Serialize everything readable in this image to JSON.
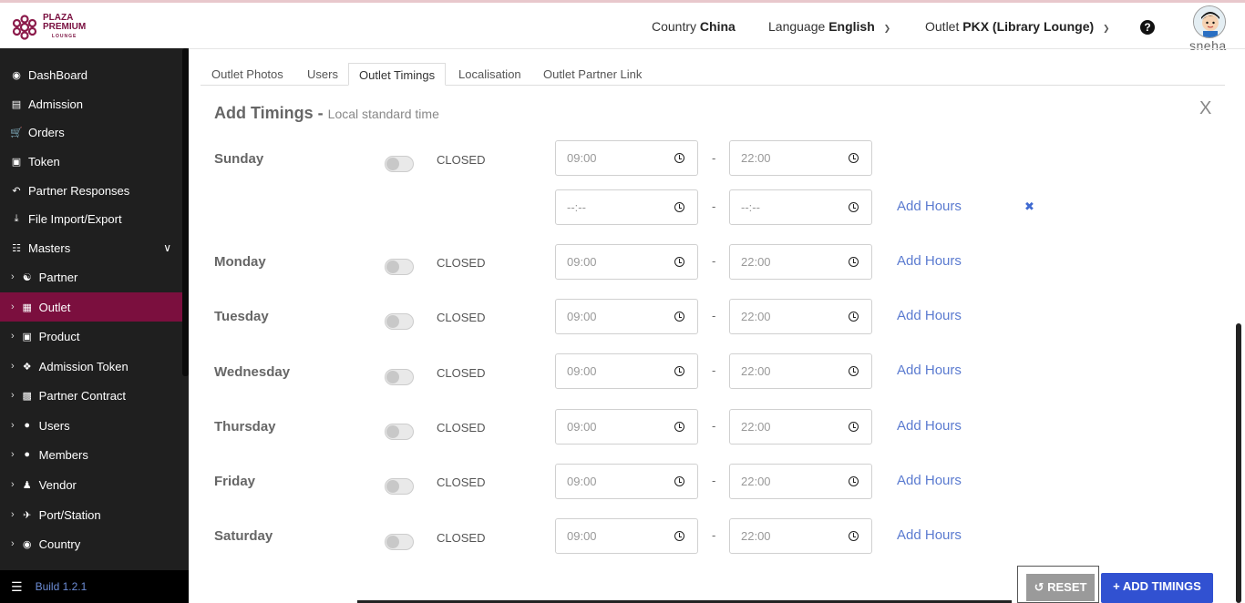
{
  "header": {
    "logo": {
      "line1": "PLAZA",
      "line2": "PREMIUM",
      "line3": "LOUNGE"
    },
    "country_label": "Country",
    "country_value": "China",
    "language_label": "Language",
    "language_value": "English",
    "outlet_label": "Outlet",
    "outlet_value": "PKX (Library Lounge)",
    "help_icon": "?",
    "username": "sneha"
  },
  "sidebar": {
    "items": [
      {
        "label": "DashBoard",
        "icon": "dashboard-icon"
      },
      {
        "label": "Admission",
        "icon": "id-card-icon"
      },
      {
        "label": "Orders",
        "icon": "cart-icon"
      },
      {
        "label": "Token",
        "icon": "document-icon"
      },
      {
        "label": "Partner Responses",
        "icon": "reply-icon"
      },
      {
        "label": "File Import/Export",
        "icon": "download-icon"
      },
      {
        "label": "Masters",
        "icon": "sitemap-icon"
      },
      {
        "label": "Partner",
        "icon": "handshake-icon"
      },
      {
        "label": "Outlet",
        "icon": "building-icon"
      },
      {
        "label": "Product",
        "icon": "gift-icon"
      },
      {
        "label": "Admission Token",
        "icon": "tag-icon"
      },
      {
        "label": "Partner Contract",
        "icon": "briefcase-icon"
      },
      {
        "label": "Users",
        "icon": "user-icon"
      },
      {
        "label": "Members",
        "icon": "users-icon"
      },
      {
        "label": "Vendor",
        "icon": "person-icon"
      },
      {
        "label": "Port/Station",
        "icon": "plane-icon"
      },
      {
        "label": "Country",
        "icon": "globe-icon"
      }
    ],
    "build": "Build 1.2.1"
  },
  "tabs": [
    "Outlet Photos",
    "Users",
    "Outlet Timings",
    "Localisation",
    "Outlet Partner Link"
  ],
  "active_tab": "Outlet Timings",
  "form": {
    "title": "Add Timings",
    "title_sep": " - ",
    "subtitle": "Local standard time",
    "close": "X",
    "closed_label": "CLOSED",
    "dash": "-",
    "add_hours": "Add Hours",
    "remove_icon": "✖",
    "days": [
      {
        "name": "Sunday",
        "open": "09:00",
        "close": "22:00",
        "closed": false
      },
      {
        "name": "Monday",
        "open": "09:00",
        "close": "22:00",
        "closed": false
      },
      {
        "name": "Tuesday",
        "open": "09:00",
        "close": "22:00",
        "closed": false
      },
      {
        "name": "Wednesday",
        "open": "09:00",
        "close": "22:00",
        "closed": false
      },
      {
        "name": "Thursday",
        "open": "09:00",
        "close": "22:00",
        "closed": false
      },
      {
        "name": "Friday",
        "open": "09:00",
        "close": "22:00",
        "closed": false
      },
      {
        "name": "Saturday",
        "open": "09:00",
        "close": "22:00",
        "closed": false
      }
    ],
    "extra_row": {
      "open": "--:--",
      "close": "--:--"
    }
  },
  "buttons": {
    "reset": "RESET",
    "reset_icon": "↺",
    "add": "ADD TIMINGS",
    "add_icon": "+"
  }
}
